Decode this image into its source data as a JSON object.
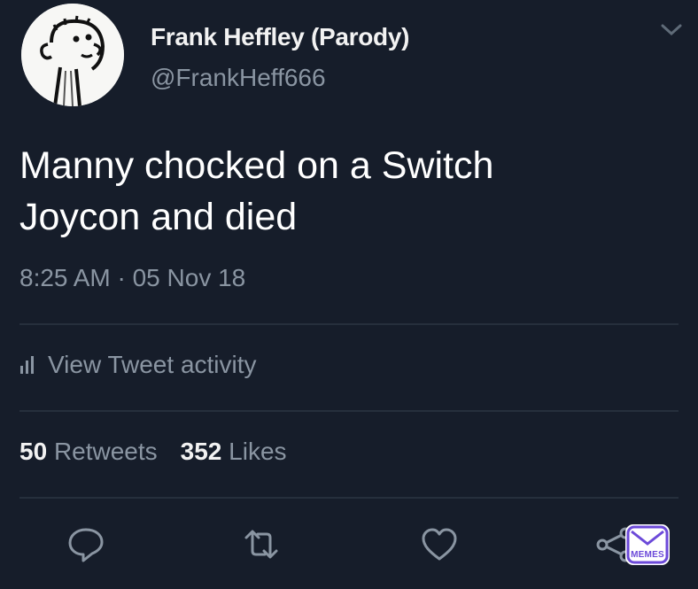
{
  "tweet": {
    "author_name": "Frank Heffley (Parody)",
    "author_handle": "@FrankHeff666",
    "text_line1": "Manny chocked on a Switch",
    "text_line2": "Joycon and died",
    "timestamp": "8:25 AM · 05 Nov 18"
  },
  "activity": {
    "label": "View Tweet activity",
    "icon": "bar-chart-icon"
  },
  "stats": {
    "retweet_count": "50",
    "retweet_label": "Retweets",
    "like_count": "352",
    "like_label": "Likes"
  },
  "actions": [
    "reply-icon",
    "retweet-icon",
    "like-icon",
    "share-icon"
  ],
  "watermark": {
    "label": "MEMES"
  },
  "colors": {
    "background": "#161d2a",
    "text": "#ffffff",
    "muted": "#8a95a2",
    "divider": "#262f3c"
  }
}
